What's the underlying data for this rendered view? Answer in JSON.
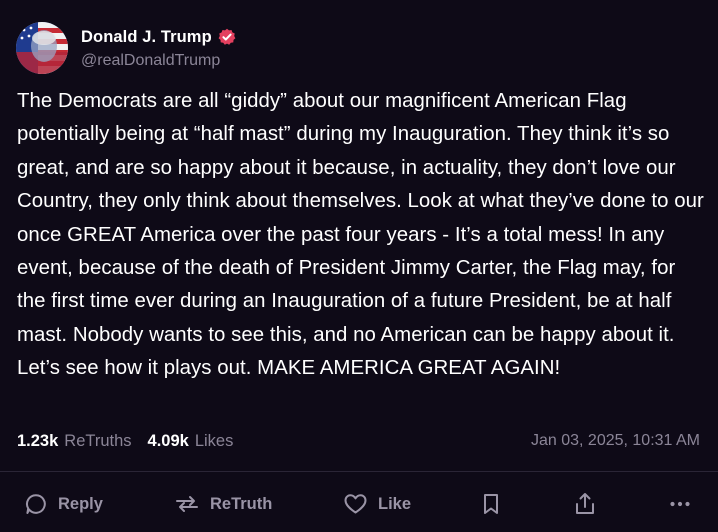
{
  "post": {
    "author": {
      "display_name": "Donald J. Trump",
      "handle": "@realDonaldTrump",
      "verified_icon": "verified-badge-icon",
      "verified_color": "#e4405f"
    },
    "text": "The Democrats are all “giddy” about our magnificent American Flag potentially being at “half mast” during my Inauguration. They think it’s so great, and are so happy about it because, in actuality, they don’t love our Country, they only think about themselves. Look at what they’ve done to our once GREAT America over the past four years - It’s a total mess! In any event, because of the death of President Jimmy Carter, the Flag may, for the first time ever during an Inauguration of a future President, be at half mast. Nobody wants to see this, and no American can be happy about it. Let’s see how it plays out. MAKE AMERICA GREAT AGAIN!",
    "stats": {
      "retruths_count": "1.23k",
      "retruths_label": "ReTruths",
      "likes_count": "4.09k",
      "likes_label": "Likes"
    },
    "timestamp": "Jan 03, 2025, 10:31 AM"
  },
  "actions": {
    "reply": {
      "label": "Reply",
      "icon": "reply-icon"
    },
    "retruth": {
      "label": "ReTruth",
      "icon": "retruth-icon"
    },
    "like": {
      "label": "Like",
      "icon": "heart-icon"
    },
    "bookmark": {
      "icon": "bookmark-icon"
    },
    "share": {
      "icon": "share-icon"
    },
    "more": {
      "icon": "more-icon"
    }
  },
  "colors": {
    "background": "#0e0a17",
    "text_primary": "#ffffff",
    "text_secondary": "#8b8597",
    "divider": "#2a2536"
  }
}
